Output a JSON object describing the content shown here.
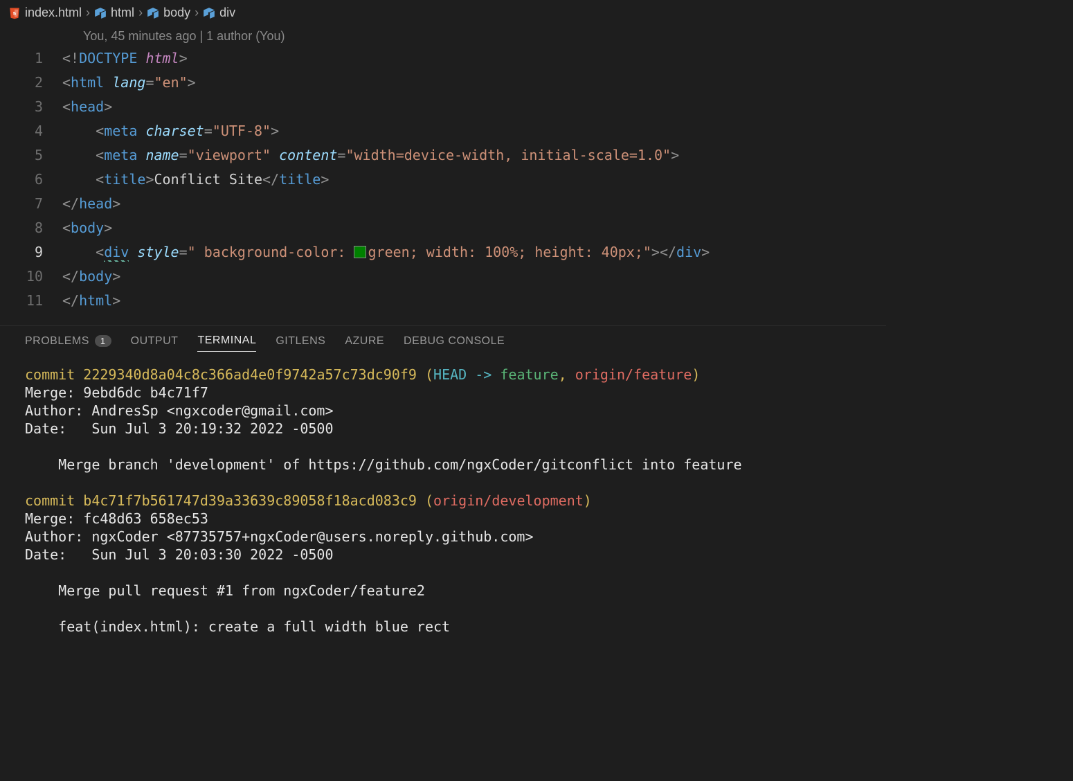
{
  "breadcrumb": {
    "file": "index.html",
    "segments": [
      "html",
      "body",
      "div"
    ]
  },
  "blame": "You, 45 minutes ago | 1 author (You)",
  "editor": {
    "lines": [
      1,
      2,
      3,
      4,
      5,
      6,
      7,
      8,
      9,
      10,
      11
    ],
    "active_line": 9,
    "code": {
      "l1_doctype": "DOCTYPE",
      "l1_html": "html",
      "l2_tag": "html",
      "l2_attr": "lang",
      "l2_val": "\"en\"",
      "l3_tag": "head",
      "l4_tag": "meta",
      "l4_attr": "charset",
      "l4_val": "\"UTF-8\"",
      "l5_tag": "meta",
      "l5_attr1": "name",
      "l5_val1": "\"viewport\"",
      "l5_attr2": "content",
      "l5_val2": "\"width=device-width, initial-scale=1.0\"",
      "l6_tag": "title",
      "l6_text": "Conflict Site",
      "l7_tag": "head",
      "l8_tag": "body",
      "l9_tag": "div",
      "l9_attr": "style",
      "l9_style_raw": "\" background-color: ",
      "l9_color_name": "green",
      "l9_style_tail": "; width: 100%; height: 40px;\"",
      "l9_swatch": "#008000",
      "l10_tag": "body",
      "l11_tag": "html"
    }
  },
  "panel": {
    "tabs": {
      "problems": "PROBLEMS",
      "problems_count": "1",
      "output": "OUTPUT",
      "terminal": "TERMINAL",
      "gitlens": "GITLENS",
      "azure": "AZURE",
      "debug": "DEBUG CONSOLE"
    }
  },
  "terminal": {
    "commit1_word": "commit",
    "commit1_sha": "2229340d8a04c8c366ad4e0f9742a57c73dc90f9",
    "commit1_open": " (",
    "commit1_head": "HEAD -> ",
    "commit1_branch": "feature",
    "commit1_sep": ", ",
    "commit1_remote": "origin/feature",
    "commit1_close": ")",
    "commit1_merge": "Merge: 9ebd6dc b4c71f7",
    "commit1_author": "Author: AndresSp <ngxcoder@gmail.com>",
    "commit1_date": "Date:   Sun Jul 3 20:19:32 2022 -0500",
    "commit1_msg": "    Merge branch 'development' of https://github.com/ngxCoder/gitconflict into feature",
    "commit2_word": "commit",
    "commit2_sha": "b4c71f7b561747d39a33639c89058f18acd083c9",
    "commit2_open": " (",
    "commit2_remote": "origin/development",
    "commit2_close": ")",
    "commit2_merge": "Merge: fc48d63 658ec53",
    "commit2_author": "Author: ngxCoder <87735757+ngxCoder@users.noreply.github.com>",
    "commit2_date": "Date:   Sun Jul 3 20:03:30 2022 -0500",
    "commit2_msg": "    Merge pull request #1 from ngxCoder/feature2",
    "commit2_msg2": "    feat(index.html): create a full width blue rect"
  }
}
